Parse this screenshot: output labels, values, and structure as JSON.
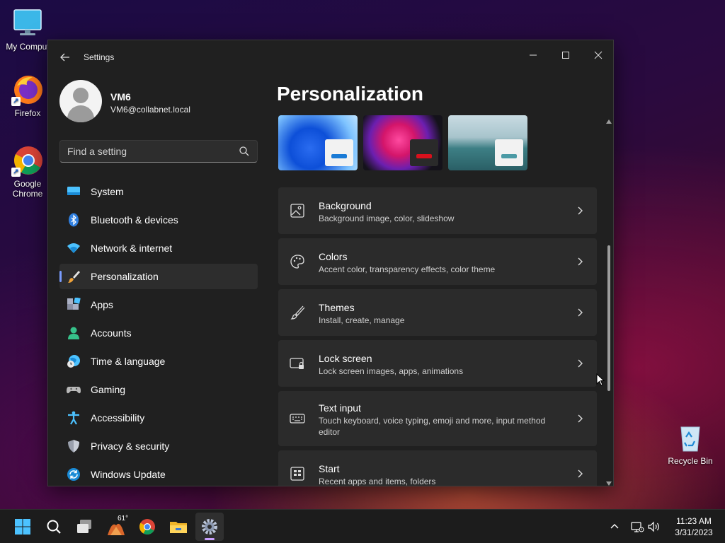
{
  "desktop": {
    "icons": [
      {
        "label": "My Comput"
      },
      {
        "label": "Firefox"
      },
      {
        "label": "Google Chrome"
      },
      {
        "label": "Recycle Bin"
      }
    ]
  },
  "window": {
    "title": "Settings",
    "controls": {
      "minimize": "—",
      "maximize": "☐",
      "close": "✕"
    }
  },
  "profile": {
    "name": "VM6",
    "email": "VM6@collabnet.local"
  },
  "search": {
    "placeholder": "Find a setting"
  },
  "nav": {
    "items": [
      {
        "label": "System"
      },
      {
        "label": "Bluetooth & devices"
      },
      {
        "label": "Network & internet"
      },
      {
        "label": "Personalization"
      },
      {
        "label": "Apps"
      },
      {
        "label": "Accounts"
      },
      {
        "label": "Time & language"
      },
      {
        "label": "Gaming"
      },
      {
        "label": "Accessibility"
      },
      {
        "label": "Privacy & security"
      },
      {
        "label": "Windows Update"
      }
    ]
  },
  "main": {
    "title": "Personalization",
    "cards": [
      {
        "title": "Background",
        "subtitle": "Background image, color, slideshow"
      },
      {
        "title": "Colors",
        "subtitle": "Accent color, transparency effects, color theme"
      },
      {
        "title": "Themes",
        "subtitle": "Install, create, manage"
      },
      {
        "title": "Lock screen",
        "subtitle": "Lock screen images, apps, animations"
      },
      {
        "title": "Text input",
        "subtitle": "Touch keyboard, voice typing, emoji and more, input method editor"
      },
      {
        "title": "Start",
        "subtitle": "Recent apps and items, folders"
      }
    ]
  },
  "taskbar": {
    "weather_temp": "61°",
    "clock_time": "11:23 AM",
    "clock_date": "3/31/2023"
  },
  "colors": {
    "accent": "#7a9cff",
    "window_bg": "#202020",
    "card_bg": "#2b2b2b"
  }
}
